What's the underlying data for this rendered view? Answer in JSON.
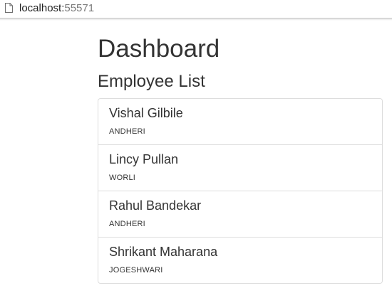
{
  "browser": {
    "url_host": "localhost:",
    "url_port": "55571"
  },
  "page": {
    "title": "Dashboard",
    "section_title": "Employee List"
  },
  "employees": [
    {
      "name": "Vishal Gilbile",
      "location": "ANDHERI"
    },
    {
      "name": "Lincy Pullan",
      "location": "WORLI"
    },
    {
      "name": "Rahul Bandekar",
      "location": "ANDHERI"
    },
    {
      "name": "Shrikant Maharana",
      "location": "JOGESHWARI"
    }
  ]
}
